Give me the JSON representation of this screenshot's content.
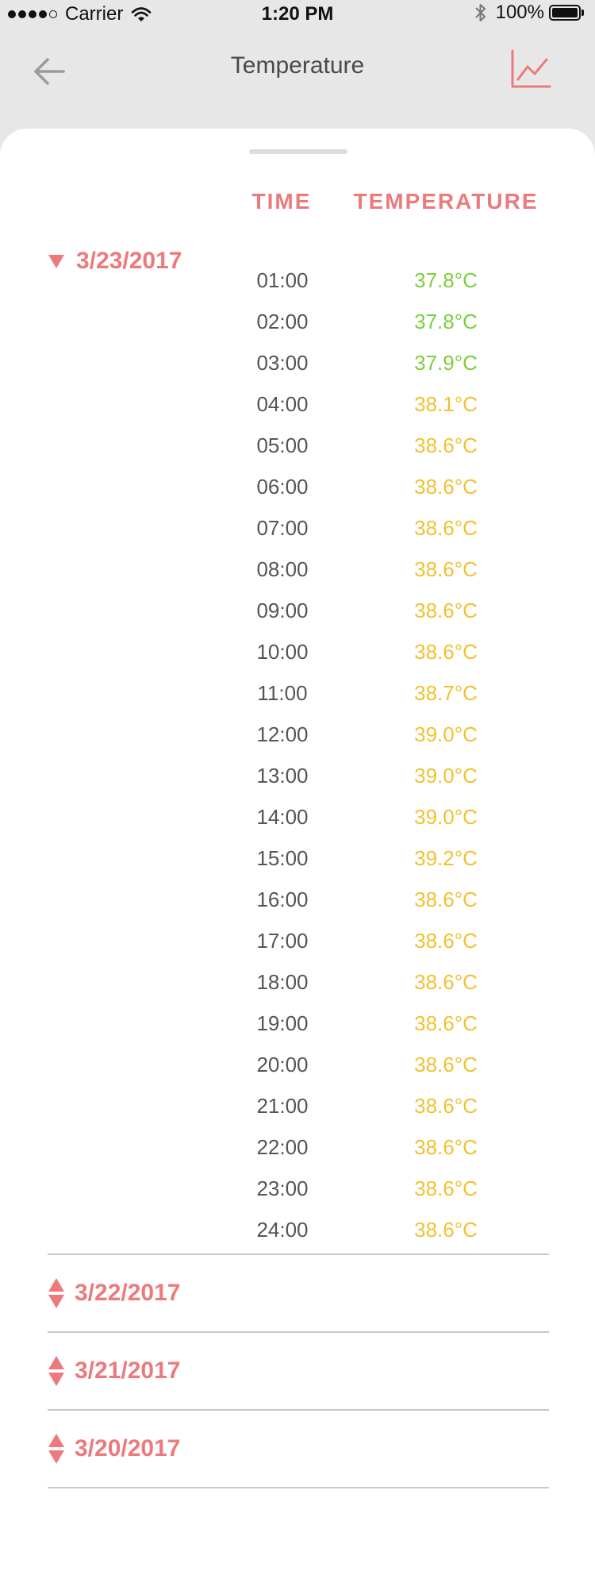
{
  "status_bar": {
    "carrier": "Carrier",
    "time": "1:20 PM",
    "battery": "100%"
  },
  "nav": {
    "title": "Temperature"
  },
  "colors": {
    "accent": "#ec7a7c",
    "normal": "#7dcf3a",
    "elevated": "#f2c12e"
  },
  "columns": {
    "time": "TIME",
    "temperature": "TEMPERATURE"
  },
  "expanded_day": {
    "date": "3/23/2017",
    "readings": [
      {
        "time": "01:00",
        "temp": "37.8°C",
        "level": "normal"
      },
      {
        "time": "02:00",
        "temp": "37.8°C",
        "level": "normal"
      },
      {
        "time": "03:00",
        "temp": "37.9°C",
        "level": "normal"
      },
      {
        "time": "04:00",
        "temp": "38.1°C",
        "level": "elevated"
      },
      {
        "time": "05:00",
        "temp": "38.6°C",
        "level": "elevated"
      },
      {
        "time": "06:00",
        "temp": "38.6°C",
        "level": "elevated"
      },
      {
        "time": "07:00",
        "temp": "38.6°C",
        "level": "elevated"
      },
      {
        "time": "08:00",
        "temp": "38.6°C",
        "level": "elevated"
      },
      {
        "time": "09:00",
        "temp": "38.6°C",
        "level": "elevated"
      },
      {
        "time": "10:00",
        "temp": "38.6°C",
        "level": "elevated"
      },
      {
        "time": "11:00",
        "temp": "38.7°C",
        "level": "elevated"
      },
      {
        "time": "12:00",
        "temp": "39.0°C",
        "level": "elevated"
      },
      {
        "time": "13:00",
        "temp": "39.0°C",
        "level": "elevated"
      },
      {
        "time": "14:00",
        "temp": "39.0°C",
        "level": "elevated"
      },
      {
        "time": "15:00",
        "temp": "39.2°C",
        "level": "elevated"
      },
      {
        "time": "16:00",
        "temp": "38.6°C",
        "level": "elevated"
      },
      {
        "time": "17:00",
        "temp": "38.6°C",
        "level": "elevated"
      },
      {
        "time": "18:00",
        "temp": "38.6°C",
        "level": "elevated"
      },
      {
        "time": "19:00",
        "temp": "38.6°C",
        "level": "elevated"
      },
      {
        "time": "20:00",
        "temp": "38.6°C",
        "level": "elevated"
      },
      {
        "time": "21:00",
        "temp": "38.6°C",
        "level": "elevated"
      },
      {
        "time": "22:00",
        "temp": "38.6°C",
        "level": "elevated"
      },
      {
        "time": "23:00",
        "temp": "38.6°C",
        "level": "elevated"
      },
      {
        "time": "24:00",
        "temp": "38.6°C",
        "level": "elevated"
      }
    ]
  },
  "collapsed_days": [
    {
      "date": "3/22/2017"
    },
    {
      "date": "3/21/2017"
    },
    {
      "date": "3/20/2017"
    }
  ]
}
